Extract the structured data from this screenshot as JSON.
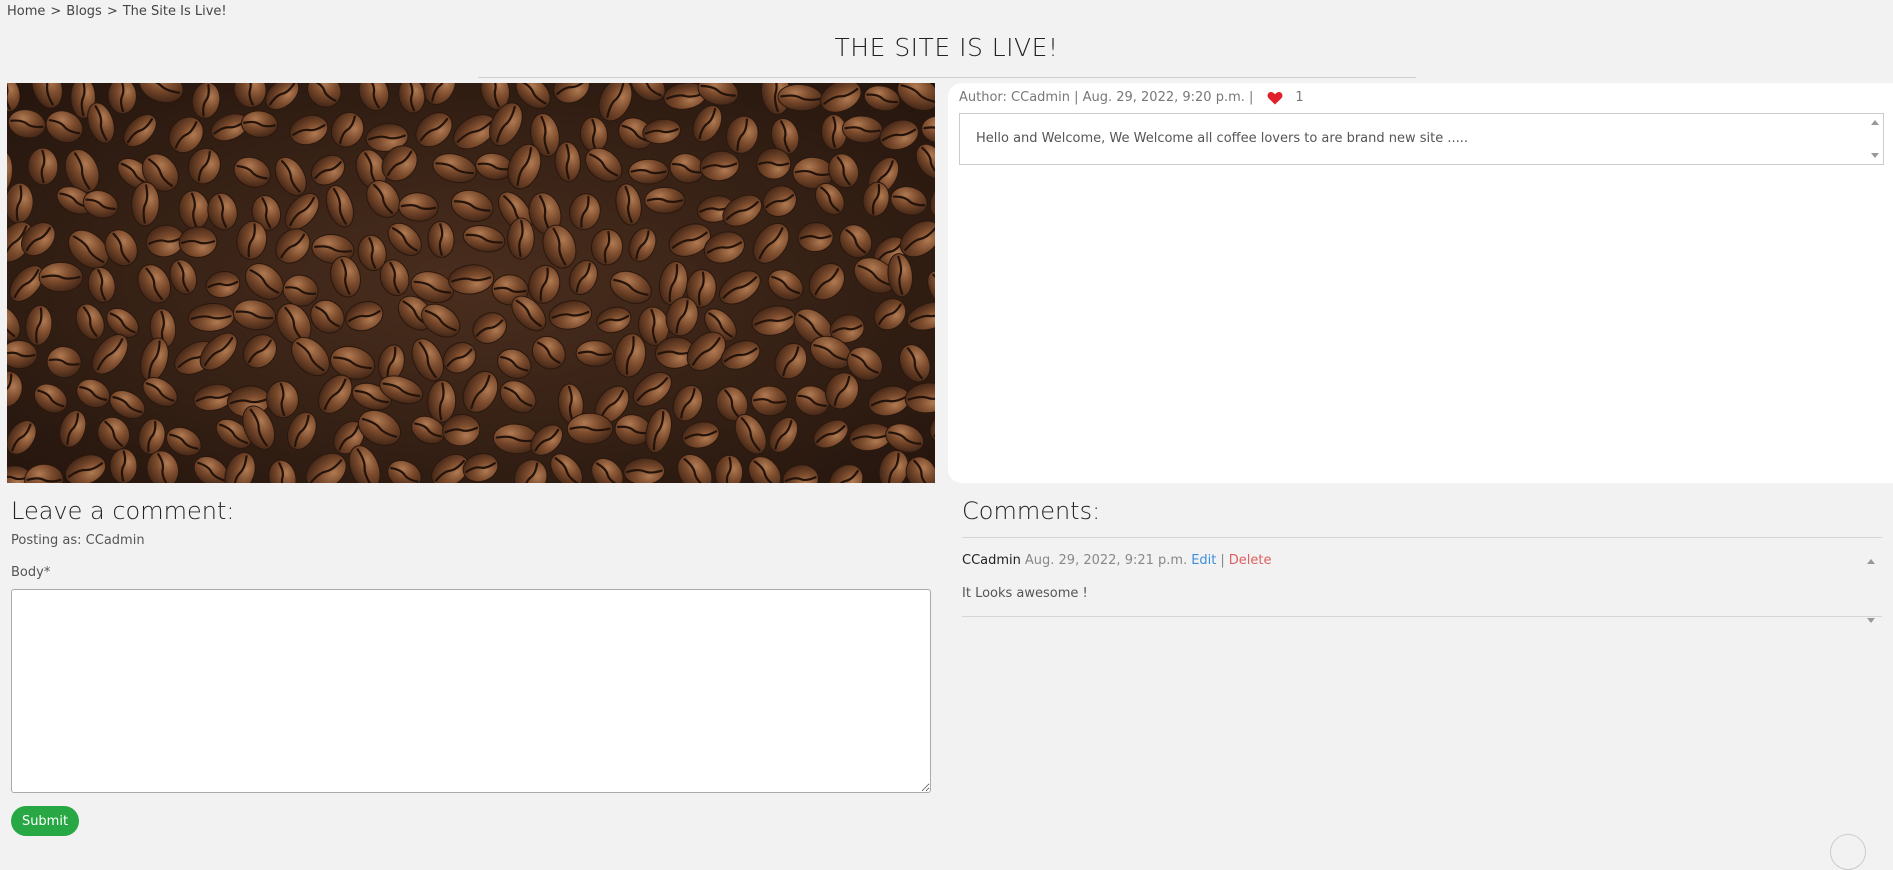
{
  "breadcrumb": {
    "items": [
      "Home",
      "Blogs",
      "The Site Is Live!"
    ],
    "separator": ">"
  },
  "page": {
    "title": "THE SITE IS LIVE!"
  },
  "hero": {
    "alt": "coffee beans"
  },
  "post": {
    "meta": "Author: CCadmin | Aug. 29, 2022, 9:20 p.m. |",
    "likes": "1",
    "heart_color": "#e0202a",
    "body": "Hello and Welcome, We Welcome all coffee lovers to are brand new site ....."
  },
  "comment_form": {
    "heading": "Leave a comment:",
    "posting_as": "Posting as: CCadmin",
    "body_label": "Body*",
    "submit_label": "Submit",
    "submit_color": "#28a745"
  },
  "comments": {
    "heading": "Comments:",
    "items": [
      {
        "author": "CCadmin",
        "date": "Aug. 29, 2022, 9:21 p.m.",
        "edit_label": "Edit",
        "separator": "|",
        "delete_label": "Delete",
        "text": "It Looks awesome !"
      }
    ]
  }
}
